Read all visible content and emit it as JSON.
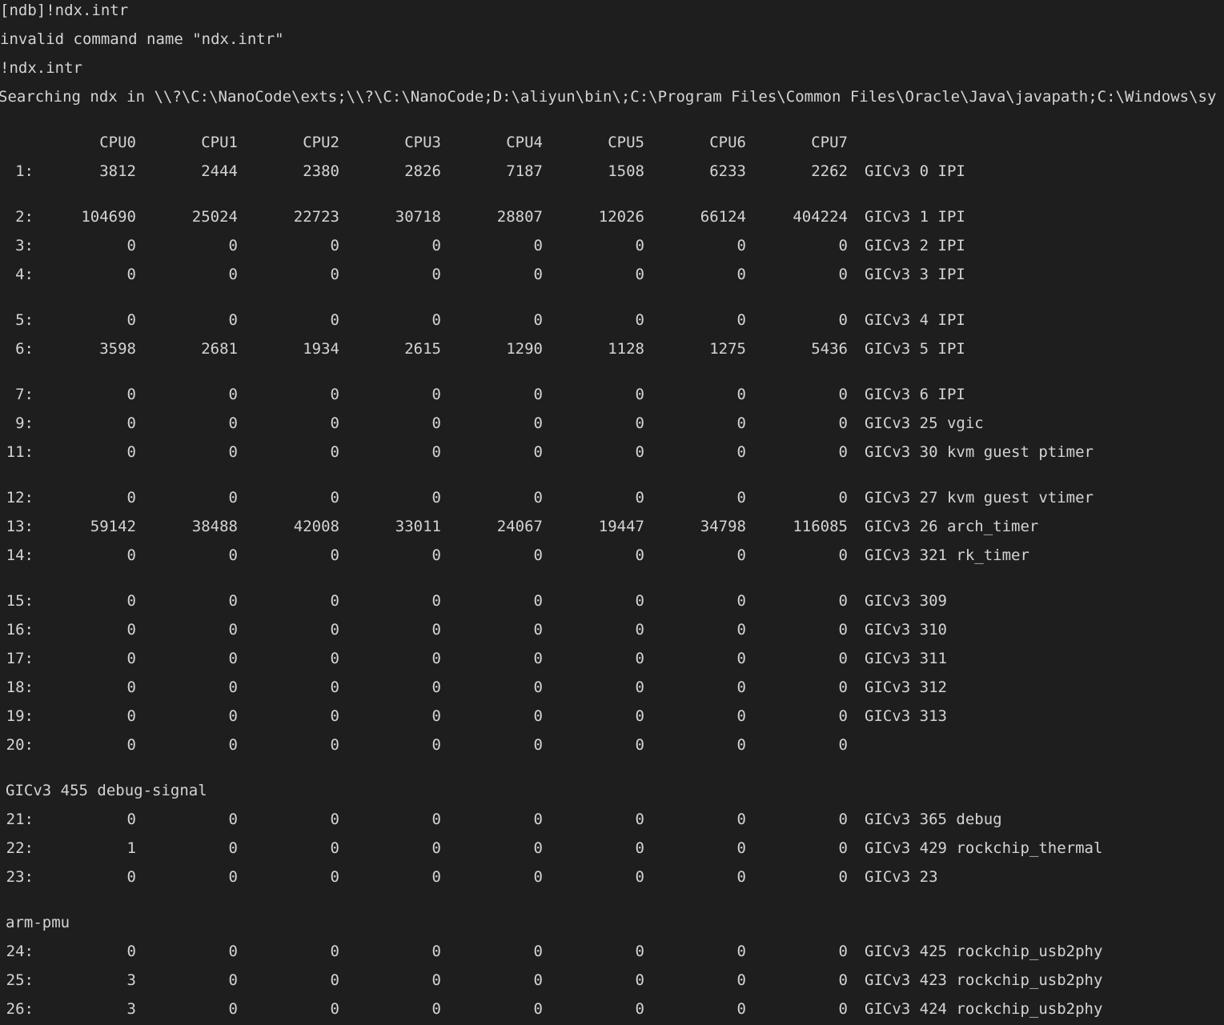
{
  "console": {
    "lines": [
      "[ndb]!ndx.intr",
      "invalid command name \"ndx.intr\"",
      "!ndx.intr",
      "Searching ndx in \\\\?\\C:\\NanoCode\\exts;\\\\?\\C:\\NanoCode;D:\\aliyun\\bin\\;C:\\Program Files\\Common Files\\Oracle\\Java\\javapath;C:\\Windows\\sy"
    ],
    "cpu_headers": [
      "CPU0",
      "CPU1",
      "CPU2",
      "CPU3",
      "CPU4",
      "CPU5",
      "CPU6",
      "CPU7"
    ],
    "rows": [
      {
        "index": "1:",
        "counts": [
          "3812",
          "2444",
          "2380",
          "2826",
          "7187",
          "1508",
          "6233",
          "2262"
        ],
        "desc": "GICv3 0 IPI"
      },
      {
        "index": "2:",
        "counts": [
          "104690",
          "25024",
          "22723",
          "30718",
          "28807",
          "12026",
          "66124",
          "404224"
        ],
        "desc": "GICv3 1 IPI"
      },
      {
        "index": "3:",
        "counts": [
          "0",
          "0",
          "0",
          "0",
          "0",
          "0",
          "0",
          "0"
        ],
        "desc": "GICv3 2 IPI"
      },
      {
        "index": "4:",
        "counts": [
          "0",
          "0",
          "0",
          "0",
          "0",
          "0",
          "0",
          "0"
        ],
        "desc": "GICv3 3 IPI"
      },
      {
        "index": "5:",
        "counts": [
          "0",
          "0",
          "0",
          "0",
          "0",
          "0",
          "0",
          "0"
        ],
        "desc": "GICv3 4 IPI"
      },
      {
        "index": "6:",
        "counts": [
          "3598",
          "2681",
          "1934",
          "2615",
          "1290",
          "1128",
          "1275",
          "5436"
        ],
        "desc": "GICv3 5 IPI"
      },
      {
        "index": "7:",
        "counts": [
          "0",
          "0",
          "0",
          "0",
          "0",
          "0",
          "0",
          "0"
        ],
        "desc": "GICv3 6 IPI"
      },
      {
        "index": "9:",
        "counts": [
          "0",
          "0",
          "0",
          "0",
          "0",
          "0",
          "0",
          "0"
        ],
        "desc": "GICv3 25 vgic"
      },
      {
        "index": "11:",
        "counts": [
          "0",
          "0",
          "0",
          "0",
          "0",
          "0",
          "0",
          "0"
        ],
        "desc": "GICv3 30 kvm guest ptimer"
      },
      {
        "index": "12:",
        "counts": [
          "0",
          "0",
          "0",
          "0",
          "0",
          "0",
          "0",
          "0"
        ],
        "desc": "GICv3 27 kvm guest vtimer"
      },
      {
        "index": "13:",
        "counts": [
          "59142",
          "38488",
          "42008",
          "33011",
          "24067",
          "19447",
          "34798",
          "116085"
        ],
        "desc": "GICv3 26 arch_timer"
      },
      {
        "index": "14:",
        "counts": [
          "0",
          "0",
          "0",
          "0",
          "0",
          "0",
          "0",
          "0"
        ],
        "desc": "GICv3 321 rk_timer"
      },
      {
        "index": "15:",
        "counts": [
          "0",
          "0",
          "0",
          "0",
          "0",
          "0",
          "0",
          "0"
        ],
        "desc": "GICv3 309"
      },
      {
        "index": "16:",
        "counts": [
          "0",
          "0",
          "0",
          "0",
          "0",
          "0",
          "0",
          "0"
        ],
        "desc": "GICv3 310"
      },
      {
        "index": "17:",
        "counts": [
          "0",
          "0",
          "0",
          "0",
          "0",
          "0",
          "0",
          "0"
        ],
        "desc": "GICv3 311"
      },
      {
        "index": "18:",
        "counts": [
          "0",
          "0",
          "0",
          "0",
          "0",
          "0",
          "0",
          "0"
        ],
        "desc": "GICv3 312"
      },
      {
        "index": "19:",
        "counts": [
          "0",
          "0",
          "0",
          "0",
          "0",
          "0",
          "0",
          "0"
        ],
        "desc": "GICv3 313"
      },
      {
        "index": "20:",
        "counts": [
          "0",
          "0",
          "0",
          "0",
          "0",
          "0",
          "0",
          "0"
        ],
        "desc": ""
      },
      {
        "text": "GICv3 455 debug-signal"
      },
      {
        "index": "21:",
        "counts": [
          "0",
          "0",
          "0",
          "0",
          "0",
          "0",
          "0",
          "0"
        ],
        "desc": "GICv3 365 debug"
      },
      {
        "index": "22:",
        "counts": [
          "1",
          "0",
          "0",
          "0",
          "0",
          "0",
          "0",
          "0"
        ],
        "desc": "GICv3 429 rockchip_thermal"
      },
      {
        "index": "23:",
        "counts": [
          "0",
          "0",
          "0",
          "0",
          "0",
          "0",
          "0",
          "0"
        ],
        "desc": "GICv3 23"
      },
      {
        "text": "arm-pmu"
      },
      {
        "index": "24:",
        "counts": [
          "0",
          "0",
          "0",
          "0",
          "0",
          "0",
          "0",
          "0"
        ],
        "desc": "GICv3 425 rockchip_usb2phy"
      },
      {
        "index": "25:",
        "counts": [
          "3",
          "0",
          "0",
          "0",
          "0",
          "0",
          "0",
          "0"
        ],
        "desc": "GICv3 423 rockchip_usb2phy"
      },
      {
        "index": "26:",
        "counts": [
          "3",
          "0",
          "0",
          "0",
          "0",
          "0",
          "0",
          "0"
        ],
        "desc": "GICv3 424 rockchip_usb2phy"
      }
    ]
  }
}
